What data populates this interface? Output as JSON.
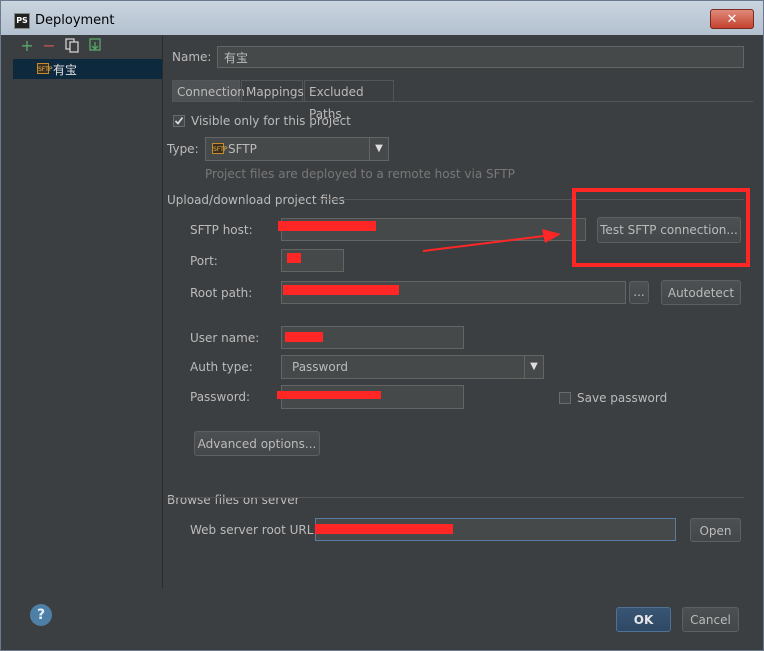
{
  "window": {
    "title": "Deployment",
    "app_icon": "PS",
    "close": "✕"
  },
  "toolbar": {
    "add": "+",
    "remove": "−",
    "copy_icon": "copy-icon",
    "export_icon": "export-icon"
  },
  "tree": {
    "selected_item": "有宝",
    "server_icon": "SFTP"
  },
  "form": {
    "name_label": "Name:",
    "name_value": "有宝",
    "tabs": [
      "Connection",
      "Mappings",
      "Excluded Paths"
    ],
    "visible_only_label": "Visible only for this project",
    "visible_only_checked": true,
    "type_label": "Type:",
    "type_value": "SFTP",
    "type_icon": "SFTP",
    "type_hint": "Project files are deployed to a remote host via SFTP",
    "upload_section": "Upload/download project files",
    "sftp_host_label": "SFTP host:",
    "test_button": "Test SFTP connection...",
    "port_label": "Port:",
    "root_path_label": "Root path:",
    "browse_button": "...",
    "autodetect_button": "Autodetect",
    "user_name_label": "User name:",
    "auth_type_label": "Auth type:",
    "auth_type_value": "Password",
    "password_label": "Password:",
    "save_password_label": "Save password",
    "save_password_checked": false,
    "advanced_button": "Advanced options...",
    "browse_section": "Browse files on server",
    "web_root_label": "Web server root URL:",
    "open_button": "Open"
  },
  "dialog": {
    "help": "?",
    "ok": "OK",
    "cancel": "Cancel"
  },
  "colors": {
    "annotation_red": "#ff2626",
    "selection": "#0d293e",
    "background": "#3c3f41"
  }
}
